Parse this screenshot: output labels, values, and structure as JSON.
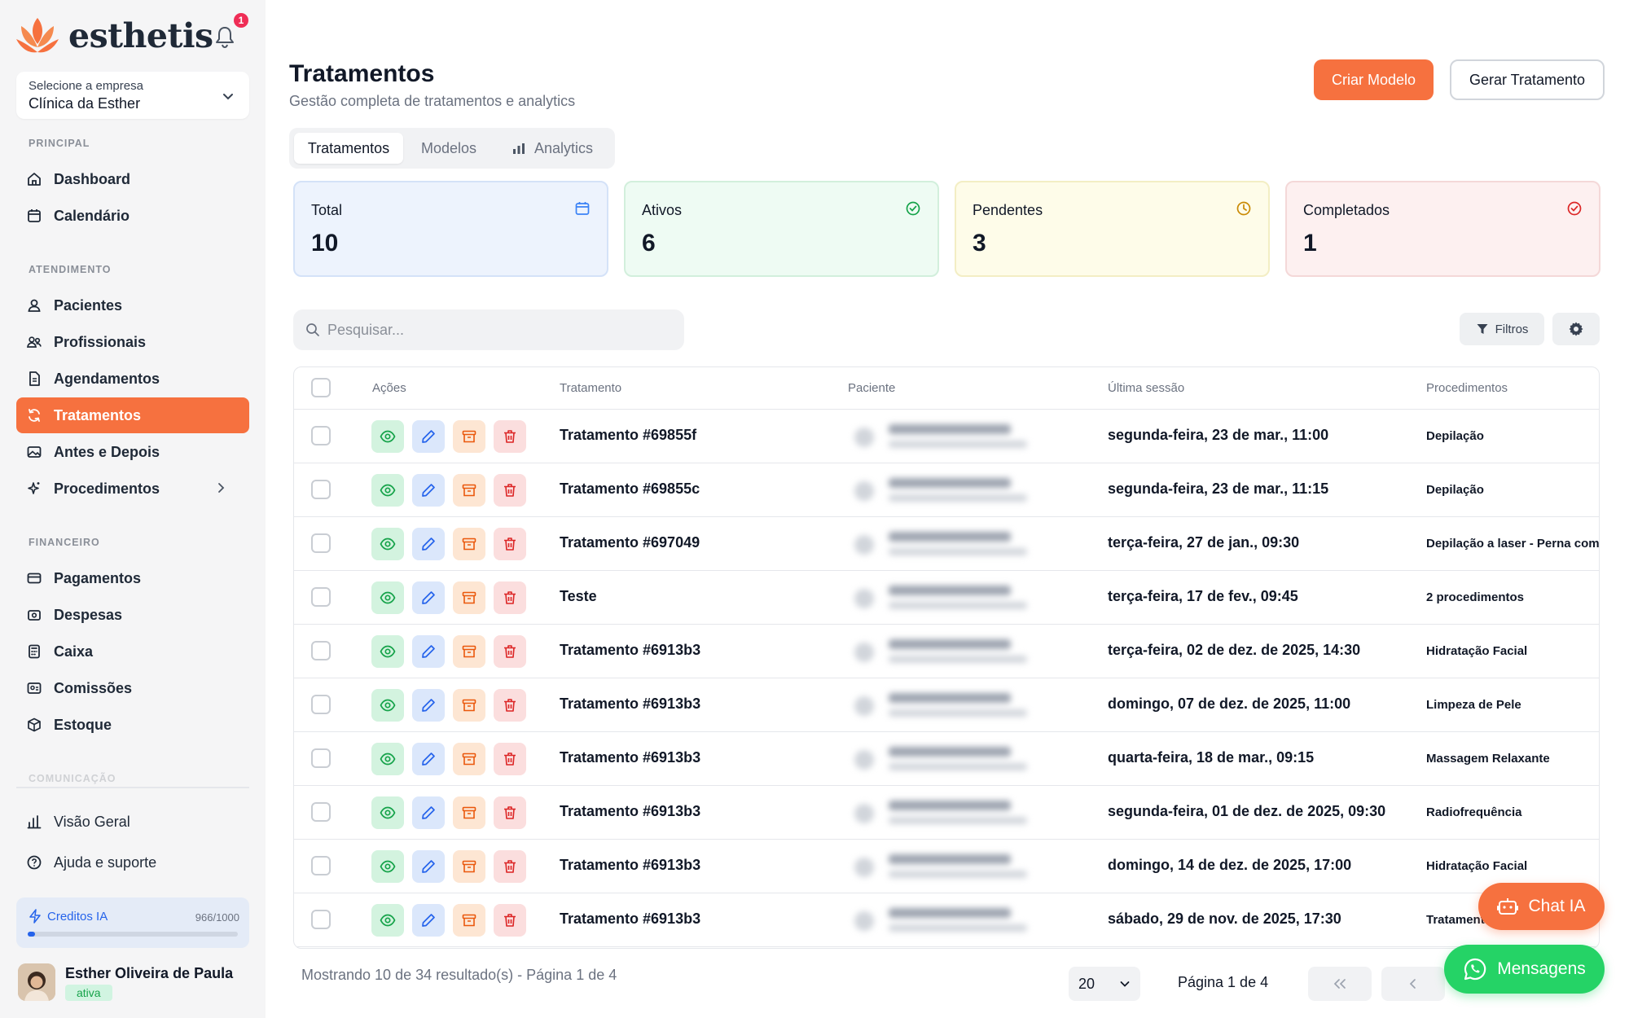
{
  "brand": {
    "name": "esthetis",
    "accent": "#f6713f"
  },
  "notifications": {
    "count": "1"
  },
  "company": {
    "label": "Selecione a empresa",
    "value": "Clínica da Esther"
  },
  "sidebar": {
    "sections": {
      "principal": "PRINCIPAL",
      "atendimento": "ATENDIMENTO",
      "financeiro": "FINANCEIRO",
      "comunicacao": "COMUNICAÇÃO"
    },
    "items": {
      "dashboard": "Dashboard",
      "calendario": "Calendário",
      "pacientes": "Pacientes",
      "profissionais": "Profissionais",
      "agendamentos": "Agendamentos",
      "tratamentos": "Tratamentos",
      "antes_depois": "Antes e Depois",
      "procedimentos": "Procedimentos",
      "pagamentos": "Pagamentos",
      "despesas": "Despesas",
      "caixa": "Caixa",
      "comissoes": "Comissões",
      "estoque": "Estoque",
      "visao_geral": "Visão Geral",
      "ajuda": "Ajuda e suporte"
    }
  },
  "credits": {
    "label": "Creditos IA",
    "value": "966/1000",
    "fraction": 0.034
  },
  "user": {
    "name": "Esther Oliveira de Paula",
    "status": "ativa"
  },
  "header": {
    "title": "Tratamentos",
    "subtitle": "Gestão completa de tratamentos e analytics",
    "create_model": "Criar Modelo",
    "generate": "Gerar Tratamento"
  },
  "tabs": [
    "Tratamentos",
    "Modelos",
    "Analytics"
  ],
  "stats": [
    {
      "label": "Total",
      "value": "10"
    },
    {
      "label": "Ativos",
      "value": "6"
    },
    {
      "label": "Pendentes",
      "value": "3"
    },
    {
      "label": "Completados",
      "value": "1"
    }
  ],
  "search": {
    "placeholder": "Pesquisar..."
  },
  "toolbar": {
    "filters": "Filtros"
  },
  "table": {
    "headers": {
      "actions": "Ações",
      "treatment": "Tratamento",
      "patient": "Paciente",
      "last_session": "Última sessão",
      "procedures": "Procedimentos"
    },
    "rows": [
      {
        "name": "Tratamento #69855f",
        "date": "segunda-feira, 23 de mar., 11:00",
        "proc": "Depilação"
      },
      {
        "name": "Tratamento #69855c",
        "date": "segunda-feira, 23 de mar., 11:15",
        "proc": "Depilação"
      },
      {
        "name": "Tratamento #697049",
        "date": "terça-feira, 27 de jan., 09:30",
        "proc": "Depilação a laser - Perna com"
      },
      {
        "name": "Teste",
        "date": "terça-feira, 17 de fev., 09:45",
        "proc": "2 procedimentos"
      },
      {
        "name": "Tratamento #6913b3",
        "date": "terça-feira, 02 de dez. de 2025, 14:30",
        "proc": "Hidratação Facial"
      },
      {
        "name": "Tratamento #6913b3",
        "date": "domingo, 07 de dez. de 2025, 11:00",
        "proc": "Limpeza de Pele"
      },
      {
        "name": "Tratamento #6913b3",
        "date": "quarta-feira, 18 de mar., 09:15",
        "proc": "Massagem Relaxante"
      },
      {
        "name": "Tratamento #6913b3",
        "date": "segunda-feira, 01 de dez. de 2025, 09:30",
        "proc": "Radiofrequência"
      },
      {
        "name": "Tratamento #6913b3",
        "date": "domingo, 14 de dez. de 2025, 17:00",
        "proc": "Hidratação Facial"
      },
      {
        "name": "Tratamento #6913b3",
        "date": "sábado, 29 de nov. de 2025, 17:30",
        "proc": "Tratament"
      }
    ]
  },
  "pagination": {
    "info": "Mostrando 10 de 34 resultado(s) - Página 1 de 4",
    "per_page": "20",
    "page_label": "Página 1 de 4"
  },
  "floating": {
    "chat": "Chat IA",
    "messages": "Mensagens"
  }
}
